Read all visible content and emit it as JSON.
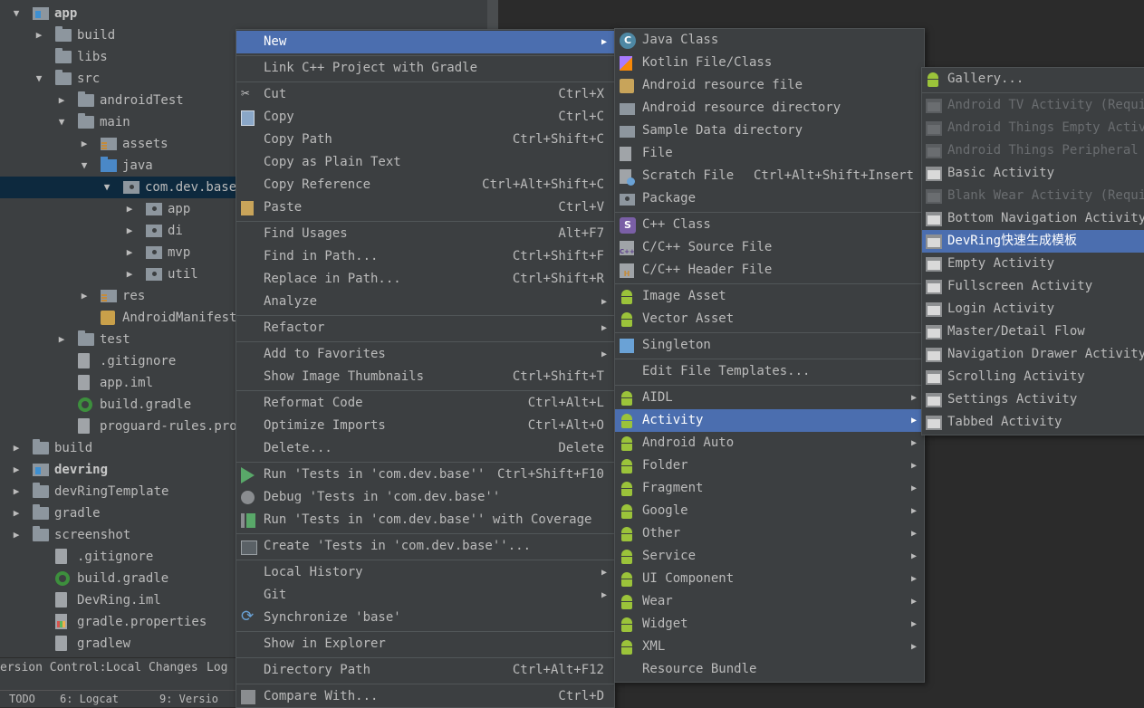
{
  "project_tree": [
    {
      "indent": 0,
      "arrow": "▼",
      "icon": "module-folder",
      "label": "app",
      "bold": true
    },
    {
      "indent": 1,
      "arrow": "▶",
      "icon": "folder",
      "label": "build"
    },
    {
      "indent": 1,
      "arrow": "",
      "icon": "folder",
      "label": "libs"
    },
    {
      "indent": 1,
      "arrow": "▼",
      "icon": "folder",
      "label": "src"
    },
    {
      "indent": 2,
      "arrow": "▶",
      "icon": "folder",
      "label": "androidTest"
    },
    {
      "indent": 2,
      "arrow": "▼",
      "icon": "folder",
      "label": "main"
    },
    {
      "indent": 3,
      "arrow": "▶",
      "icon": "res-folder",
      "label": "assets"
    },
    {
      "indent": 3,
      "arrow": "▼",
      "icon": "source-folder",
      "label": "java"
    },
    {
      "indent": 4,
      "arrow": "▼",
      "icon": "package",
      "label": "com.dev.base",
      "selected": true
    },
    {
      "indent": 5,
      "arrow": "▶",
      "icon": "package",
      "label": "app"
    },
    {
      "indent": 5,
      "arrow": "▶",
      "icon": "package",
      "label": "di"
    },
    {
      "indent": 5,
      "arrow": "▶",
      "icon": "package",
      "label": "mvp"
    },
    {
      "indent": 5,
      "arrow": "▶",
      "icon": "package",
      "label": "util"
    },
    {
      "indent": 3,
      "arrow": "▶",
      "icon": "res-folder",
      "label": "res"
    },
    {
      "indent": 3,
      "arrow": "",
      "icon": "manifest",
      "label": "AndroidManifest."
    },
    {
      "indent": 2,
      "arrow": "▶",
      "icon": "folder",
      "label": "test"
    },
    {
      "indent": 2,
      "arrow": "",
      "icon": "file",
      "label": ".gitignore"
    },
    {
      "indent": 2,
      "arrow": "",
      "icon": "file",
      "label": "app.iml"
    },
    {
      "indent": 2,
      "arrow": "",
      "icon": "gradle",
      "label": "build.gradle"
    },
    {
      "indent": 2,
      "arrow": "",
      "icon": "file",
      "label": "proguard-rules.pro"
    },
    {
      "indent": 0,
      "arrow": "▶",
      "icon": "folder",
      "label": "build"
    },
    {
      "indent": 0,
      "arrow": "▶",
      "icon": "module-folder",
      "label": "devring",
      "bold": true
    },
    {
      "indent": 0,
      "arrow": "▶",
      "icon": "folder",
      "label": "devRingTemplate"
    },
    {
      "indent": 0,
      "arrow": "▶",
      "icon": "folder",
      "label": "gradle"
    },
    {
      "indent": 0,
      "arrow": "▶",
      "icon": "folder",
      "label": "screenshot"
    },
    {
      "indent": 1,
      "arrow": "",
      "icon": "file",
      "label": ".gitignore"
    },
    {
      "indent": 1,
      "arrow": "",
      "icon": "gradle",
      "label": "build.gradle"
    },
    {
      "indent": 1,
      "arrow": "",
      "icon": "file",
      "label": "DevRing.iml"
    },
    {
      "indent": 1,
      "arrow": "",
      "icon": "properties",
      "label": "gradle.properties"
    },
    {
      "indent": 1,
      "arrow": "",
      "icon": "file",
      "label": "gradlew"
    }
  ],
  "version_control_bar": {
    "label": "ersion Control:",
    "tab_local": "Local Changes",
    "tab_log": "Log"
  },
  "status_bar": {
    "todo": "TODO",
    "logcat": "6: Logcat",
    "version": "9: Versio"
  },
  "context_menu": {
    "items": [
      {
        "type": "item",
        "label": "New",
        "submenu": true,
        "highlighted": true
      },
      {
        "type": "sep"
      },
      {
        "type": "item",
        "label": "Link C++ Project with Gradle"
      },
      {
        "type": "sep"
      },
      {
        "type": "item",
        "icon": "scissors-icon",
        "label": "Cut",
        "shortcut": "Ctrl+X"
      },
      {
        "type": "item",
        "icon": "copy-icon",
        "label": "Copy",
        "shortcut": "Ctrl+C"
      },
      {
        "type": "item",
        "label": "Copy Path",
        "shortcut": "Ctrl+Shift+C"
      },
      {
        "type": "item",
        "label": "Copy as Plain Text"
      },
      {
        "type": "item",
        "label": "Copy Reference",
        "shortcut": "Ctrl+Alt+Shift+C"
      },
      {
        "type": "item",
        "icon": "paste-icon",
        "label": "Paste",
        "shortcut": "Ctrl+V"
      },
      {
        "type": "sep"
      },
      {
        "type": "item",
        "label": "Find Usages",
        "shortcut": "Alt+F7"
      },
      {
        "type": "item",
        "label": "Find in Path...",
        "shortcut": "Ctrl+Shift+F"
      },
      {
        "type": "item",
        "label": "Replace in Path...",
        "shortcut": "Ctrl+Shift+R"
      },
      {
        "type": "item",
        "label": "Analyze",
        "submenu": true
      },
      {
        "type": "sep"
      },
      {
        "type": "item",
        "label": "Refactor",
        "submenu": true
      },
      {
        "type": "sep"
      },
      {
        "type": "item",
        "label": "Add to Favorites",
        "submenu": true
      },
      {
        "type": "item",
        "label": "Show Image Thumbnails",
        "shortcut": "Ctrl+Shift+T"
      },
      {
        "type": "sep"
      },
      {
        "type": "item",
        "label": "Reformat Code",
        "shortcut": "Ctrl+Alt+L"
      },
      {
        "type": "item",
        "label": "Optimize Imports",
        "shortcut": "Ctrl+Alt+O"
      },
      {
        "type": "item",
        "label": "Delete...",
        "shortcut": "Delete"
      },
      {
        "type": "sep"
      },
      {
        "type": "item",
        "icon": "run-icon",
        "label": "Run 'Tests in 'com.dev.base''",
        "shortcut": "Ctrl+Shift+F10"
      },
      {
        "type": "item",
        "icon": "debug-icon",
        "label": "Debug 'Tests in 'com.dev.base''"
      },
      {
        "type": "item",
        "icon": "coverage-icon",
        "label": "Run 'Tests in 'com.dev.base'' with Coverage"
      },
      {
        "type": "sep"
      },
      {
        "type": "item",
        "icon": "create-test-icon",
        "label": "Create 'Tests in 'com.dev.base''..."
      },
      {
        "type": "sep"
      },
      {
        "type": "item",
        "label": "Local History",
        "submenu": true
      },
      {
        "type": "item",
        "label": "Git",
        "submenu": true
      },
      {
        "type": "item",
        "icon": "sync-icon",
        "label": "Synchronize 'base'"
      },
      {
        "type": "sep"
      },
      {
        "type": "item",
        "label": "Show in Explorer"
      },
      {
        "type": "sep"
      },
      {
        "type": "item",
        "label": "Directory Path",
        "shortcut": "Ctrl+Alt+F12"
      },
      {
        "type": "sep"
      },
      {
        "type": "item",
        "icon": "compare-icon",
        "label": "Compare With...",
        "shortcut": "Ctrl+D"
      }
    ]
  },
  "new_submenu": {
    "items": [
      {
        "type": "item",
        "icon": "java-class-icon",
        "label": "Java Class"
      },
      {
        "type": "item",
        "icon": "kotlin-icon",
        "label": "Kotlin File/Class"
      },
      {
        "type": "item",
        "icon": "resource-file-icon",
        "label": "Android resource file"
      },
      {
        "type": "item",
        "icon": "folder-icon",
        "label": "Android resource directory"
      },
      {
        "type": "item",
        "icon": "folder-icon",
        "label": "Sample Data directory"
      },
      {
        "type": "item",
        "icon": "file-icon",
        "label": "File"
      },
      {
        "type": "item",
        "icon": "scratch-file-icon",
        "label": "Scratch File",
        "shortcut": "Ctrl+Alt+Shift+Insert"
      },
      {
        "type": "item",
        "icon": "package-icon",
        "label": "Package"
      },
      {
        "type": "sep"
      },
      {
        "type": "item",
        "icon": "cpp-class-icon",
        "label": "C++ Class"
      },
      {
        "type": "item",
        "icon": "cpp-source-icon",
        "label": "C/C++ Source File"
      },
      {
        "type": "item",
        "icon": "cpp-header-icon",
        "label": "C/C++ Header File"
      },
      {
        "type": "sep"
      },
      {
        "type": "item",
        "icon": "android-icon",
        "label": "Image Asset"
      },
      {
        "type": "item",
        "icon": "android-icon",
        "label": "Vector Asset"
      },
      {
        "type": "sep"
      },
      {
        "type": "item",
        "icon": "singleton-icon",
        "label": "Singleton"
      },
      {
        "type": "sep"
      },
      {
        "type": "item",
        "label": "Edit File Templates..."
      },
      {
        "type": "sep"
      },
      {
        "type": "item",
        "icon": "android-icon",
        "label": "AIDL",
        "submenu": true
      },
      {
        "type": "item",
        "icon": "android-icon",
        "label": "Activity",
        "submenu": true,
        "highlighted": true
      },
      {
        "type": "item",
        "icon": "android-icon",
        "label": "Android Auto",
        "submenu": true
      },
      {
        "type": "item",
        "icon": "android-icon",
        "label": "Folder",
        "submenu": true
      },
      {
        "type": "item",
        "icon": "android-icon",
        "label": "Fragment",
        "submenu": true
      },
      {
        "type": "item",
        "icon": "android-icon",
        "label": "Google",
        "submenu": true
      },
      {
        "type": "item",
        "icon": "android-icon",
        "label": "Other",
        "submenu": true
      },
      {
        "type": "item",
        "icon": "android-icon",
        "label": "Service",
        "submenu": true
      },
      {
        "type": "item",
        "icon": "android-icon",
        "label": "UI Component",
        "submenu": true
      },
      {
        "type": "item",
        "icon": "android-icon",
        "label": "Wear",
        "submenu": true
      },
      {
        "type": "item",
        "icon": "android-icon",
        "label": "Widget",
        "submenu": true
      },
      {
        "type": "item",
        "icon": "android-icon",
        "label": "XML",
        "submenu": true
      },
      {
        "type": "item",
        "icon": "resource-bundle-icon",
        "label": "Resource Bundle"
      }
    ]
  },
  "activity_submenu": {
    "items": [
      {
        "type": "item",
        "icon": "android-icon",
        "label": "Gallery..."
      },
      {
        "type": "sep"
      },
      {
        "type": "item",
        "icon": "activity-template-icon",
        "label": "Android TV Activity (Requir",
        "disabled": true
      },
      {
        "type": "item",
        "icon": "activity-template-icon",
        "label": "Android Things Empty Activi",
        "disabled": true
      },
      {
        "type": "item",
        "icon": "activity-template-icon",
        "label": "Android Things Peripheral A",
        "disabled": true
      },
      {
        "type": "item",
        "icon": "activity-template-icon",
        "label": "Basic Activity"
      },
      {
        "type": "item",
        "icon": "activity-template-icon",
        "label": "Blank Wear Activity (Requir",
        "disabled": true
      },
      {
        "type": "item",
        "icon": "activity-template-icon",
        "label": "Bottom Navigation Activity"
      },
      {
        "type": "item",
        "icon": "activity-template-icon",
        "label": "DevRing快速生成模板",
        "highlighted": true
      },
      {
        "type": "item",
        "icon": "activity-template-icon",
        "label": "Empty Activity"
      },
      {
        "type": "item",
        "icon": "activity-template-icon",
        "label": "Fullscreen Activity"
      },
      {
        "type": "item",
        "icon": "activity-template-icon",
        "label": "Login Activity"
      },
      {
        "type": "item",
        "icon": "activity-template-icon",
        "label": "Master/Detail Flow"
      },
      {
        "type": "item",
        "icon": "activity-template-icon",
        "label": "Navigation Drawer Activity"
      },
      {
        "type": "item",
        "icon": "activity-template-icon",
        "label": "Scrolling Activity"
      },
      {
        "type": "item",
        "icon": "activity-template-icon",
        "label": "Settings Activity"
      },
      {
        "type": "item",
        "icon": "activity-template-icon",
        "label": "Tabbed Activity"
      }
    ]
  },
  "colors": {
    "highlight": "#4b6eaf",
    "menu_bg": "#3c3f41",
    "editor_bg": "#2b2b2b",
    "selection_tree": "#0d293e",
    "android_green": "#9bc33a"
  }
}
